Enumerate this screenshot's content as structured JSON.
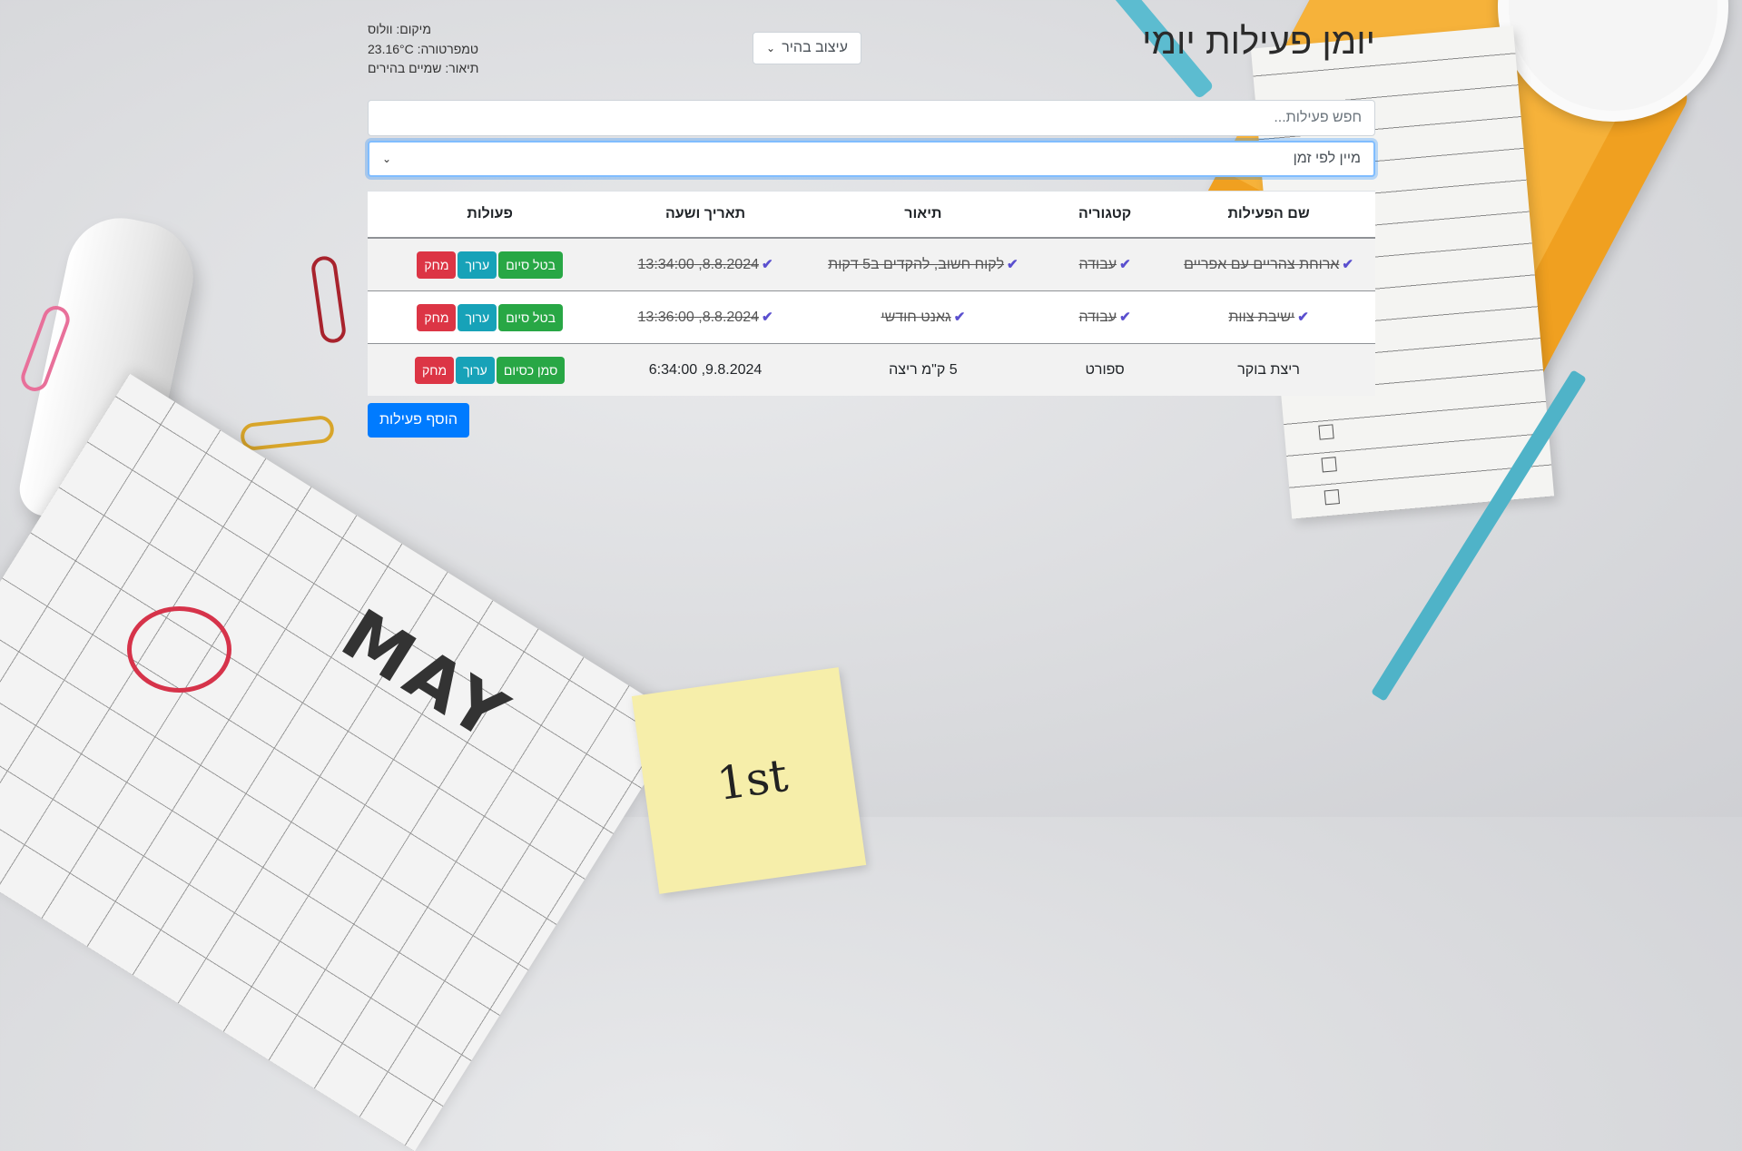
{
  "app": {
    "title": "יומן פעילות יומי",
    "theme_select": {
      "value": "עיצוב בהיר"
    },
    "weather": {
      "location": "מיקום: וולוס",
      "temperature": "טמפרטורה: 23.16°C",
      "description": "תיאור: שמיים בהירים"
    },
    "search": {
      "placeholder": "חפש פעילות...",
      "value": ""
    },
    "sort_select": {
      "value": "מיין לפי זמן"
    },
    "add_button": "הוסף פעילות"
  },
  "table": {
    "headers": [
      "שם הפעילות",
      "קטגוריה",
      "תיאור",
      "תאריך ושעה",
      "פעולות"
    ],
    "rows": [
      {
        "name": "ארוחת צהריים עם אפריים",
        "category": "עבודה",
        "description": "לקוח חשוב, להקדים ב5 דקות",
        "datetime": "8.8.2024, 13:34:00",
        "completed": true,
        "toggle_label": "בטל סיום",
        "edit_label": "ערוך",
        "delete_label": "מחק"
      },
      {
        "name": "ישיבת צוות",
        "category": "עבודה",
        "description": "גאנט חודשי",
        "datetime": "8.8.2024, 13:36:00",
        "completed": true,
        "toggle_label": "בטל סיום",
        "edit_label": "ערוך",
        "delete_label": "מחק"
      },
      {
        "name": "ריצת בוקר",
        "category": "ספורט",
        "description": "5 ק\"מ ריצה",
        "datetime": "9.8.2024, 6:34:00",
        "completed": false,
        "toggle_label": "סמן כסיום",
        "edit_label": "ערוך",
        "delete_label": "מחק"
      }
    ]
  },
  "background": {
    "calendar_month": "MAY",
    "sticky_note": "1st"
  },
  "colors": {
    "primary": "#007bff",
    "success": "#28a745",
    "info": "#17a2b8",
    "danger": "#dc3545",
    "check": "#5a4fcf"
  },
  "icons": {
    "check": "check-icon",
    "chevron": "chevron-down-icon"
  }
}
